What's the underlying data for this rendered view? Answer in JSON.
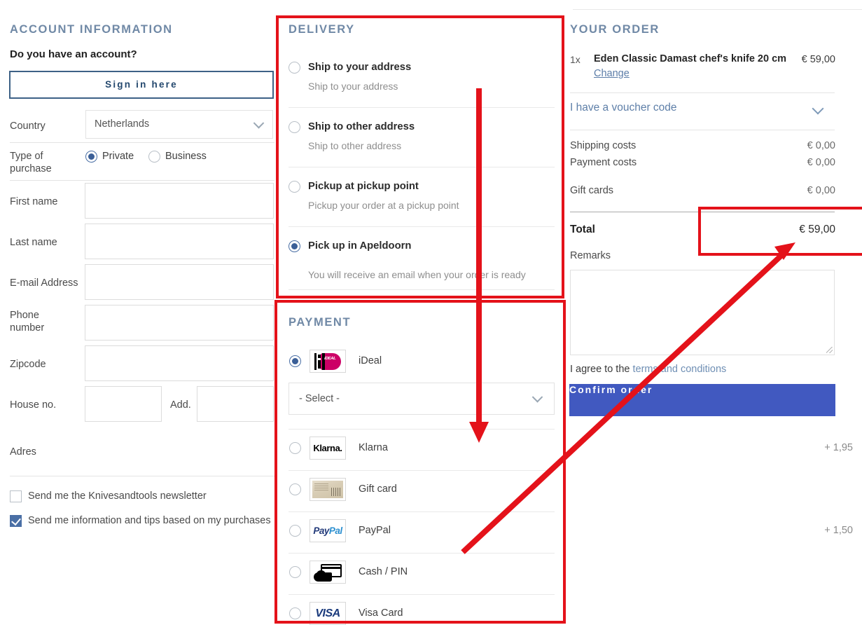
{
  "account": {
    "title": "Account information",
    "have_account": "Do you have an account?",
    "signin_label": "Sign in here",
    "country_label": "Country",
    "country_value": "Netherlands",
    "type_label_line1": "Type of",
    "type_label_line2": "purchase",
    "type_options": [
      {
        "label": "Private",
        "selected": true
      },
      {
        "label": "Business",
        "selected": false
      }
    ],
    "fields": [
      {
        "label": "First name",
        "value": "",
        "placeholder": ""
      },
      {
        "label": "Last name",
        "value": "",
        "placeholder": ""
      },
      {
        "label": "E-mail Address",
        "value": "",
        "placeholder": ""
      },
      {
        "label": "Phone number",
        "value": "",
        "placeholder": ""
      },
      {
        "label": "Zipcode",
        "value": "",
        "placeholder": ""
      }
    ],
    "house_label": "House no.",
    "house_value": "",
    "add_label": "Add.",
    "add_value": "",
    "adres_label": "Adres",
    "checkboxes": [
      {
        "label": "Send me the Knivesandtools newsletter",
        "checked": false
      },
      {
        "label": "Send me information and tips based on my purchases",
        "checked": true
      }
    ]
  },
  "delivery": {
    "title": "Delivery",
    "options": [
      {
        "title": "Ship to your address",
        "sub": "Ship to your address",
        "selected": false
      },
      {
        "title": "Ship to other address",
        "sub": "Ship to other address",
        "selected": false
      },
      {
        "title": "Pickup at pickup point",
        "sub": "Pickup your order at a pickup point",
        "selected": false
      },
      {
        "title": "Pick up in Apeldoorn",
        "sub": "You will receive an email when your order is ready",
        "selected": true
      }
    ]
  },
  "payment": {
    "title": "Payment",
    "select_value": "- Select -",
    "methods": [
      {
        "label": "iDeal",
        "logo": "ideal-logo",
        "extra": "",
        "selected": true
      },
      {
        "label": "Klarna",
        "logo": "klarna-logo",
        "extra": "+ 1,95",
        "selected": false
      },
      {
        "label": "Gift card",
        "logo": "giftcard-logo",
        "extra": "",
        "selected": false
      },
      {
        "label": "PayPal",
        "logo": "paypal-logo",
        "extra": "+ 1,50",
        "selected": false
      },
      {
        "label": "Cash / PIN",
        "logo": "cash-pin-logo",
        "extra": "",
        "selected": false
      },
      {
        "label": "Visa Card",
        "logo": "visa-logo",
        "extra": "",
        "selected": false
      }
    ],
    "logo_text": {
      "klarna": "Klarna.",
      "paypal_part1": "Pay",
      "paypal_part2": "Pal",
      "visa": "VISA",
      "ideal": "iDEAL"
    }
  },
  "order": {
    "title": "Your order",
    "item_qty": "1x",
    "item_name": "Eden Classic Damast chef's knife 20 cm",
    "item_price": "€ 59,00",
    "change_label": "Change",
    "voucher_label": "I have a voucher code",
    "costs": [
      {
        "label": "Shipping costs",
        "value": "€ 0,00"
      },
      {
        "label": "Payment costs",
        "value": "€ 0,00"
      },
      {
        "label": "Gift cards",
        "value": "€ 0,00"
      }
    ],
    "total_label": "Total",
    "total_value": "€ 59,00",
    "remarks_label": "Remarks",
    "remarks_value": "",
    "terms_prefix": "I agree to the ",
    "terms_link": "terms and conditions",
    "confirm_label": "Confirm order"
  },
  "colors": {
    "heading": "#7089a6",
    "confirm_button": "#4159c0",
    "annotation_red": "#e4121a",
    "link_blue": "#5c7da8",
    "radio_selected": "#3b5f97",
    "ideal_pink": "#cc0066"
  }
}
